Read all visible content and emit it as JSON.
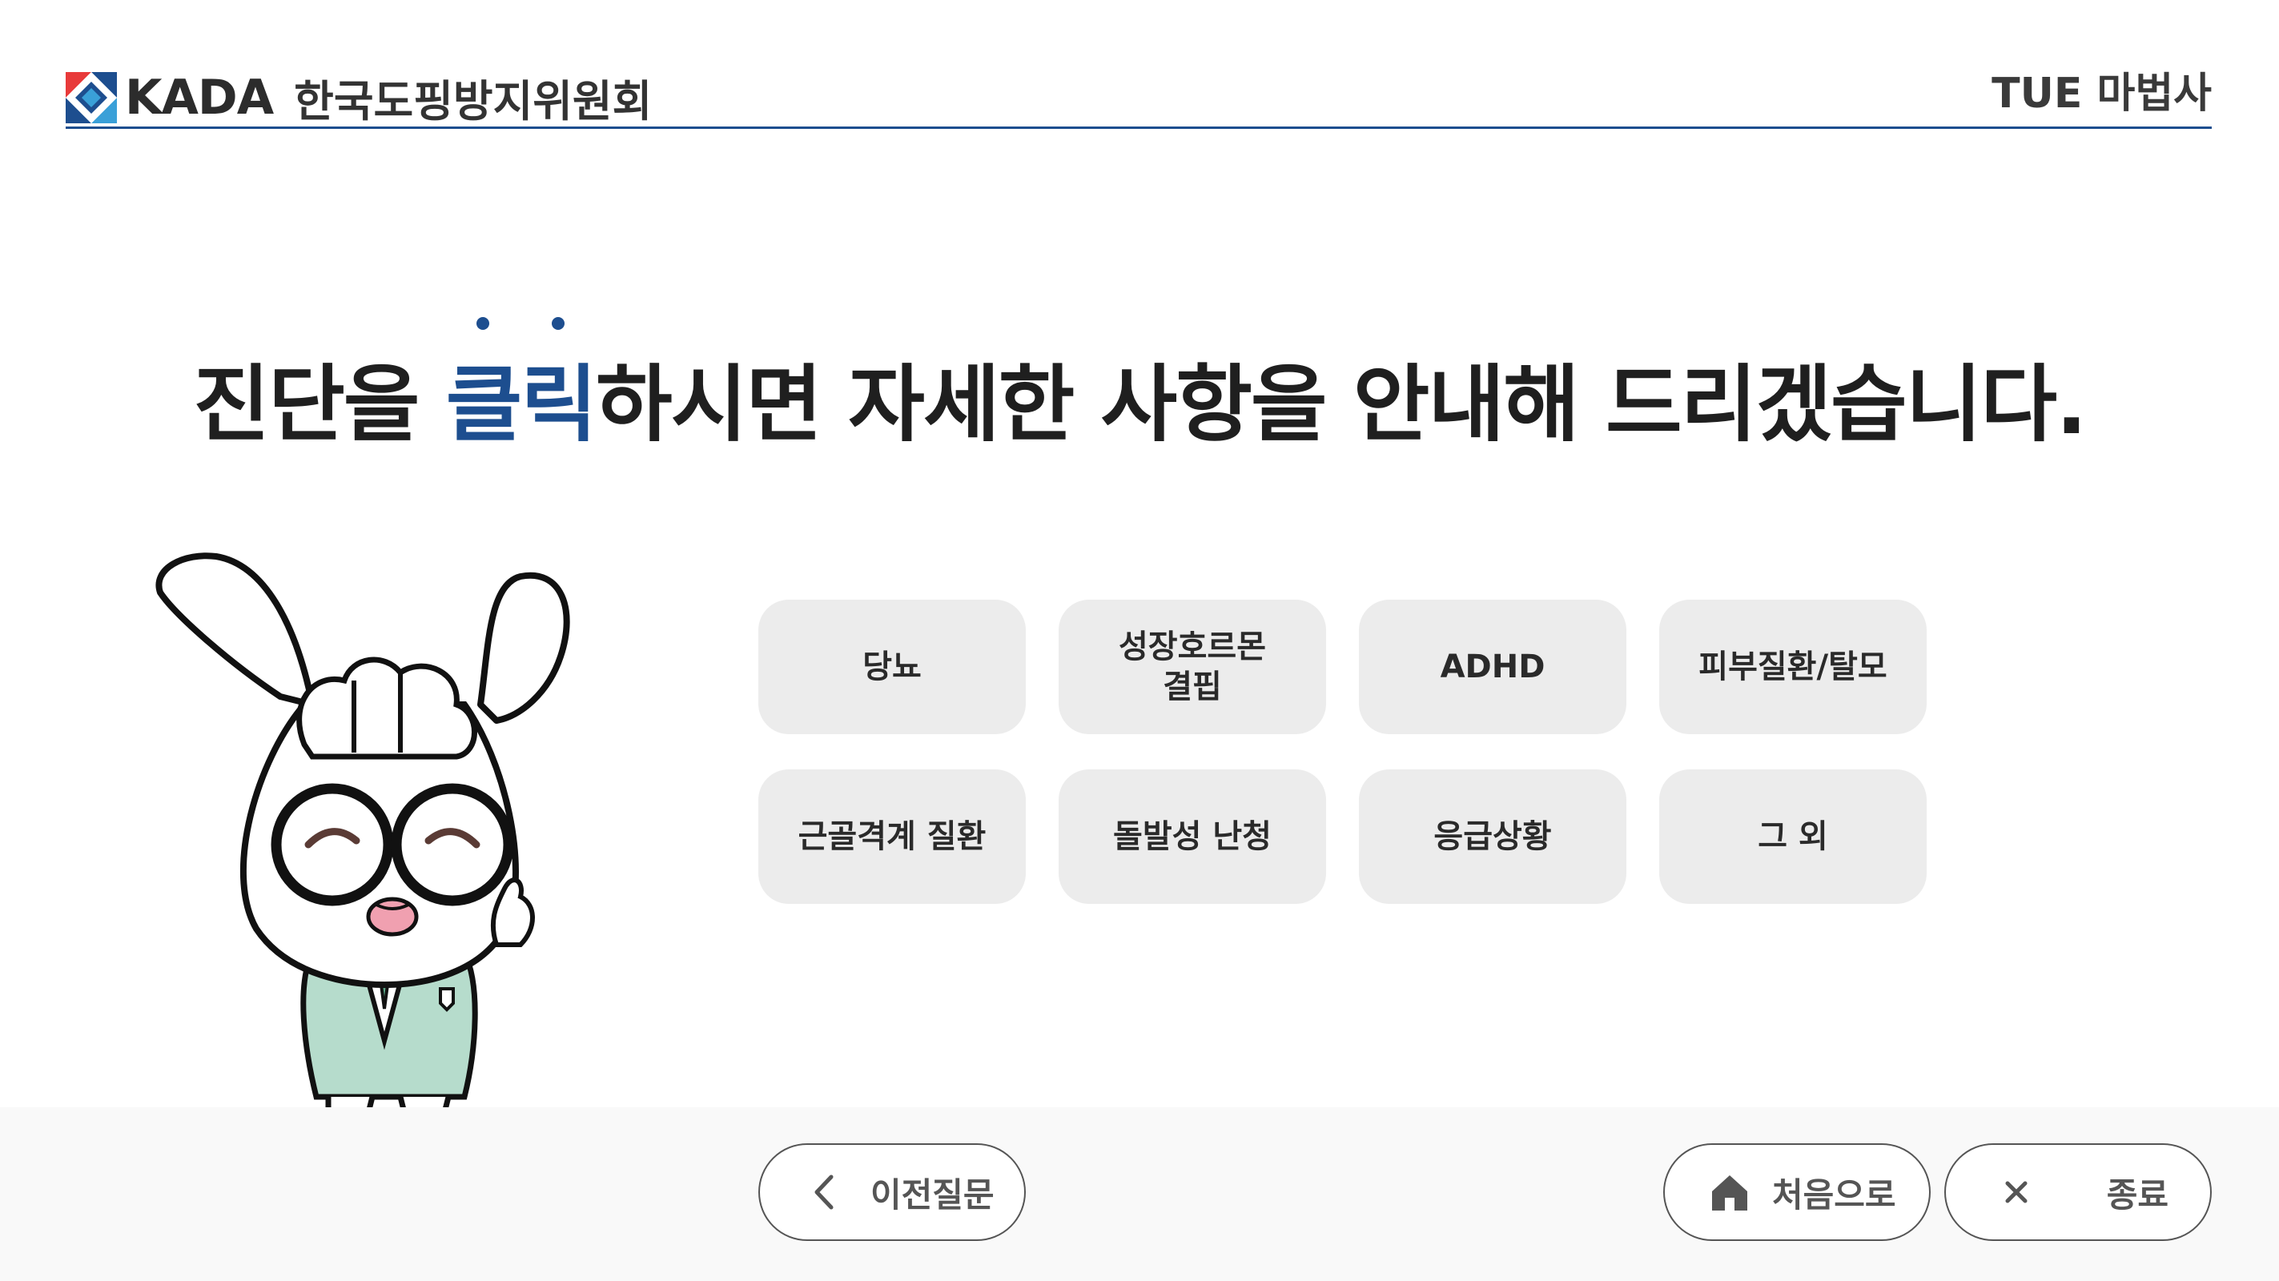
{
  "header": {
    "logo_text": "KADA",
    "logo_sub": "한국도핑방지위원회",
    "right_title": "TUE 마법사",
    "logo_colors": [
      "#1d4e8f",
      "#e83a3a",
      "#3aa0d8"
    ]
  },
  "headline": {
    "before": "진단을 ",
    "emphasis": "클릭",
    "after": "하시면 자세한 사항을 안내해 드리겠습니다.",
    "accent_color": "#1d4e8f"
  },
  "mascot": {
    "icon": "rabbit-doctor-mascot"
  },
  "diagnoses": [
    "당뇨",
    "성장호르몬\n결핍",
    "ADHD",
    "피부질환/탈모",
    "근골격계 질환",
    "돌발성 난청",
    "응급상황",
    "그 외"
  ],
  "footer": {
    "prev": {
      "label": "이전질문",
      "icon": "chevron-left-icon"
    },
    "home": {
      "label": "처음으로",
      "icon": "home-icon"
    },
    "exit": {
      "label": "종료",
      "icon": "close-icon"
    }
  }
}
